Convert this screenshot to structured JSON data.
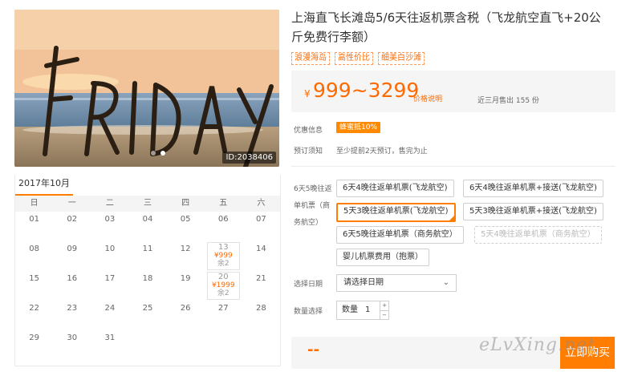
{
  "hero": {
    "id_label": "ID:2038406",
    "art_text": "FRIDAY"
  },
  "product": {
    "title": "上海直飞长滩岛5/6天往返机票含税（飞龙航空直飞+20公斤免费行李额）",
    "tags": [
      "浪漫海岛",
      "高性价比",
      "细美白沙滩"
    ],
    "price_currency": "¥",
    "price_range": "999~3299",
    "price_explain": "价格说明",
    "sold_text": "近三月售出 155 份"
  },
  "promo": {
    "label": "优惠信息",
    "badge": "蜂蜜抵10%"
  },
  "notice": {
    "label": "预订须知",
    "text": "至少提前2天预订，售完为止"
  },
  "packages": {
    "label": "6天5晚往返单机票（商务航空）",
    "options": [
      {
        "label": "6天4晚往返单机票(飞龙航空)",
        "state": "normal"
      },
      {
        "label": "6天4晚往返单机票+接送(飞龙航空)",
        "state": "normal"
      },
      {
        "label": "5天3晚往返单机票(飞龙航空)",
        "state": "selected"
      },
      {
        "label": "5天3晚往返单机票+接送(飞龙航空)",
        "state": "normal"
      },
      {
        "label": "6天5晚往返单机票（商务航空）",
        "state": "normal"
      },
      {
        "label": "5天4晚往返单机票（商务航空）",
        "state": "disabled"
      },
      {
        "label": "婴儿机票费用（抱票）",
        "state": "normal"
      }
    ]
  },
  "date": {
    "label": "选择日期",
    "value": "请选择日期"
  },
  "quantity": {
    "label": "数量选择",
    "unit_label": "数量",
    "value": "1",
    "plus": "+",
    "minus": "−"
  },
  "buy": {
    "total": "--",
    "button": "立即购买"
  },
  "calendar": {
    "month": "2017年10月",
    "weekdays": [
      "日",
      "一",
      "二",
      "三",
      "四",
      "五",
      "六"
    ],
    "weeks": [
      [
        {
          "d": "01"
        },
        {
          "d": "02"
        },
        {
          "d": "03"
        },
        {
          "d": "04"
        },
        {
          "d": "05"
        },
        {
          "d": "06"
        },
        {
          "d": "07"
        }
      ],
      [
        {
          "d": "08"
        },
        {
          "d": "09"
        },
        {
          "d": "10"
        },
        {
          "d": "11"
        },
        {
          "d": "12"
        },
        {
          "d": "13",
          "price": "¥999",
          "remain": "余2"
        },
        {
          "d": "14"
        }
      ],
      [
        {
          "d": "15"
        },
        {
          "d": "16"
        },
        {
          "d": "17"
        },
        {
          "d": "18"
        },
        {
          "d": "19"
        },
        {
          "d": "20",
          "price": "¥1999",
          "remain": "余2"
        },
        {
          "d": "21"
        }
      ],
      [
        {
          "d": "22"
        },
        {
          "d": "23"
        },
        {
          "d": "24"
        },
        {
          "d": "25"
        },
        {
          "d": "26"
        },
        {
          "d": "27"
        },
        {
          "d": "28"
        }
      ],
      [
        {
          "d": "29"
        },
        {
          "d": "30"
        },
        {
          "d": "31"
        },
        {
          "d": ""
        },
        {
          "d": ""
        },
        {
          "d": ""
        },
        {
          "d": ""
        }
      ]
    ]
  },
  "watermark": "eLvXing.net",
  "colors": {
    "accent": "#ff7d00",
    "price": "#ff6a00"
  }
}
